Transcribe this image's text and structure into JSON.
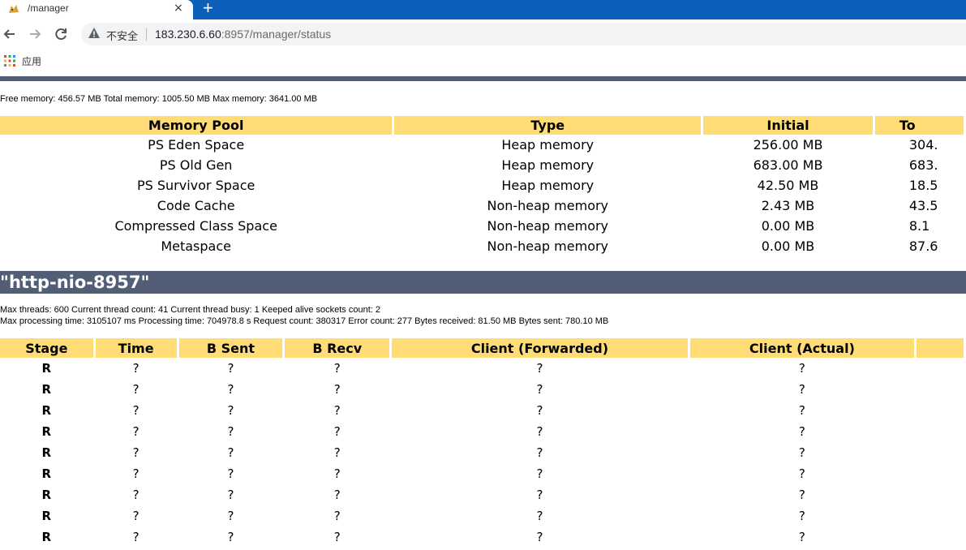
{
  "browser": {
    "tab_title": "/manager",
    "tab_close": "×",
    "new_tab": "+",
    "security_label": "不安全",
    "url_host": "183.230.6.60",
    "url_rest": ":8957/manager/status",
    "bookmarks_apps_label": "应用"
  },
  "jvm": {
    "memory_line": "Free memory: 456.57 MB Total memory: 1005.50 MB Max memory: 3641.00 MB",
    "headers": [
      "Memory Pool",
      "Type",
      "Initial",
      "To"
    ],
    "rows": [
      [
        "PS Eden Space",
        "Heap memory",
        "256.00 MB",
        "304."
      ],
      [
        "PS Old Gen",
        "Heap memory",
        "683.00 MB",
        "683."
      ],
      [
        "PS Survivor Space",
        "Heap memory",
        "42.50 MB",
        "18.5"
      ],
      [
        "Code Cache",
        "Non-heap memory",
        "2.43 MB",
        "43.5"
      ],
      [
        "Compressed Class Space",
        "Non-heap memory",
        "0.00 MB",
        "8.1"
      ],
      [
        "Metaspace",
        "Non-heap memory",
        "0.00 MB",
        "87.6"
      ]
    ]
  },
  "connector": {
    "title": "\"http-nio-8957\"",
    "thread_line": "Max threads: 600 Current thread count: 41 Current thread busy: 1 Keeped alive sockets count: 2",
    "processing_line": "Max processing time: 3105107 ms Processing time: 704978.8 s Request count: 380317 Error count: 277 Bytes received: 81.50 MB Bytes sent: 780.10 MB",
    "headers": [
      "Stage",
      "Time",
      "B Sent",
      "B Recv",
      "Client (Forwarded)",
      "Client (Actual)"
    ],
    "rows": [
      [
        "R",
        "?",
        "?",
        "?",
        "?",
        "?"
      ],
      [
        "R",
        "?",
        "?",
        "?",
        "?",
        "?"
      ],
      [
        "R",
        "?",
        "?",
        "?",
        "?",
        "?"
      ],
      [
        "R",
        "?",
        "?",
        "?",
        "?",
        "?"
      ],
      [
        "R",
        "?",
        "?",
        "?",
        "?",
        "?"
      ],
      [
        "R",
        "?",
        "?",
        "?",
        "?",
        "?"
      ],
      [
        "R",
        "?",
        "?",
        "?",
        "?",
        "?"
      ],
      [
        "R",
        "?",
        "?",
        "?",
        "?",
        "?"
      ],
      [
        "R",
        "?",
        "?",
        "?",
        "?",
        "?"
      ]
    ]
  },
  "colors": {
    "header_bar": "#525d76",
    "table_header": "#ffdc75",
    "tabstrip": "#0b5fb8"
  }
}
